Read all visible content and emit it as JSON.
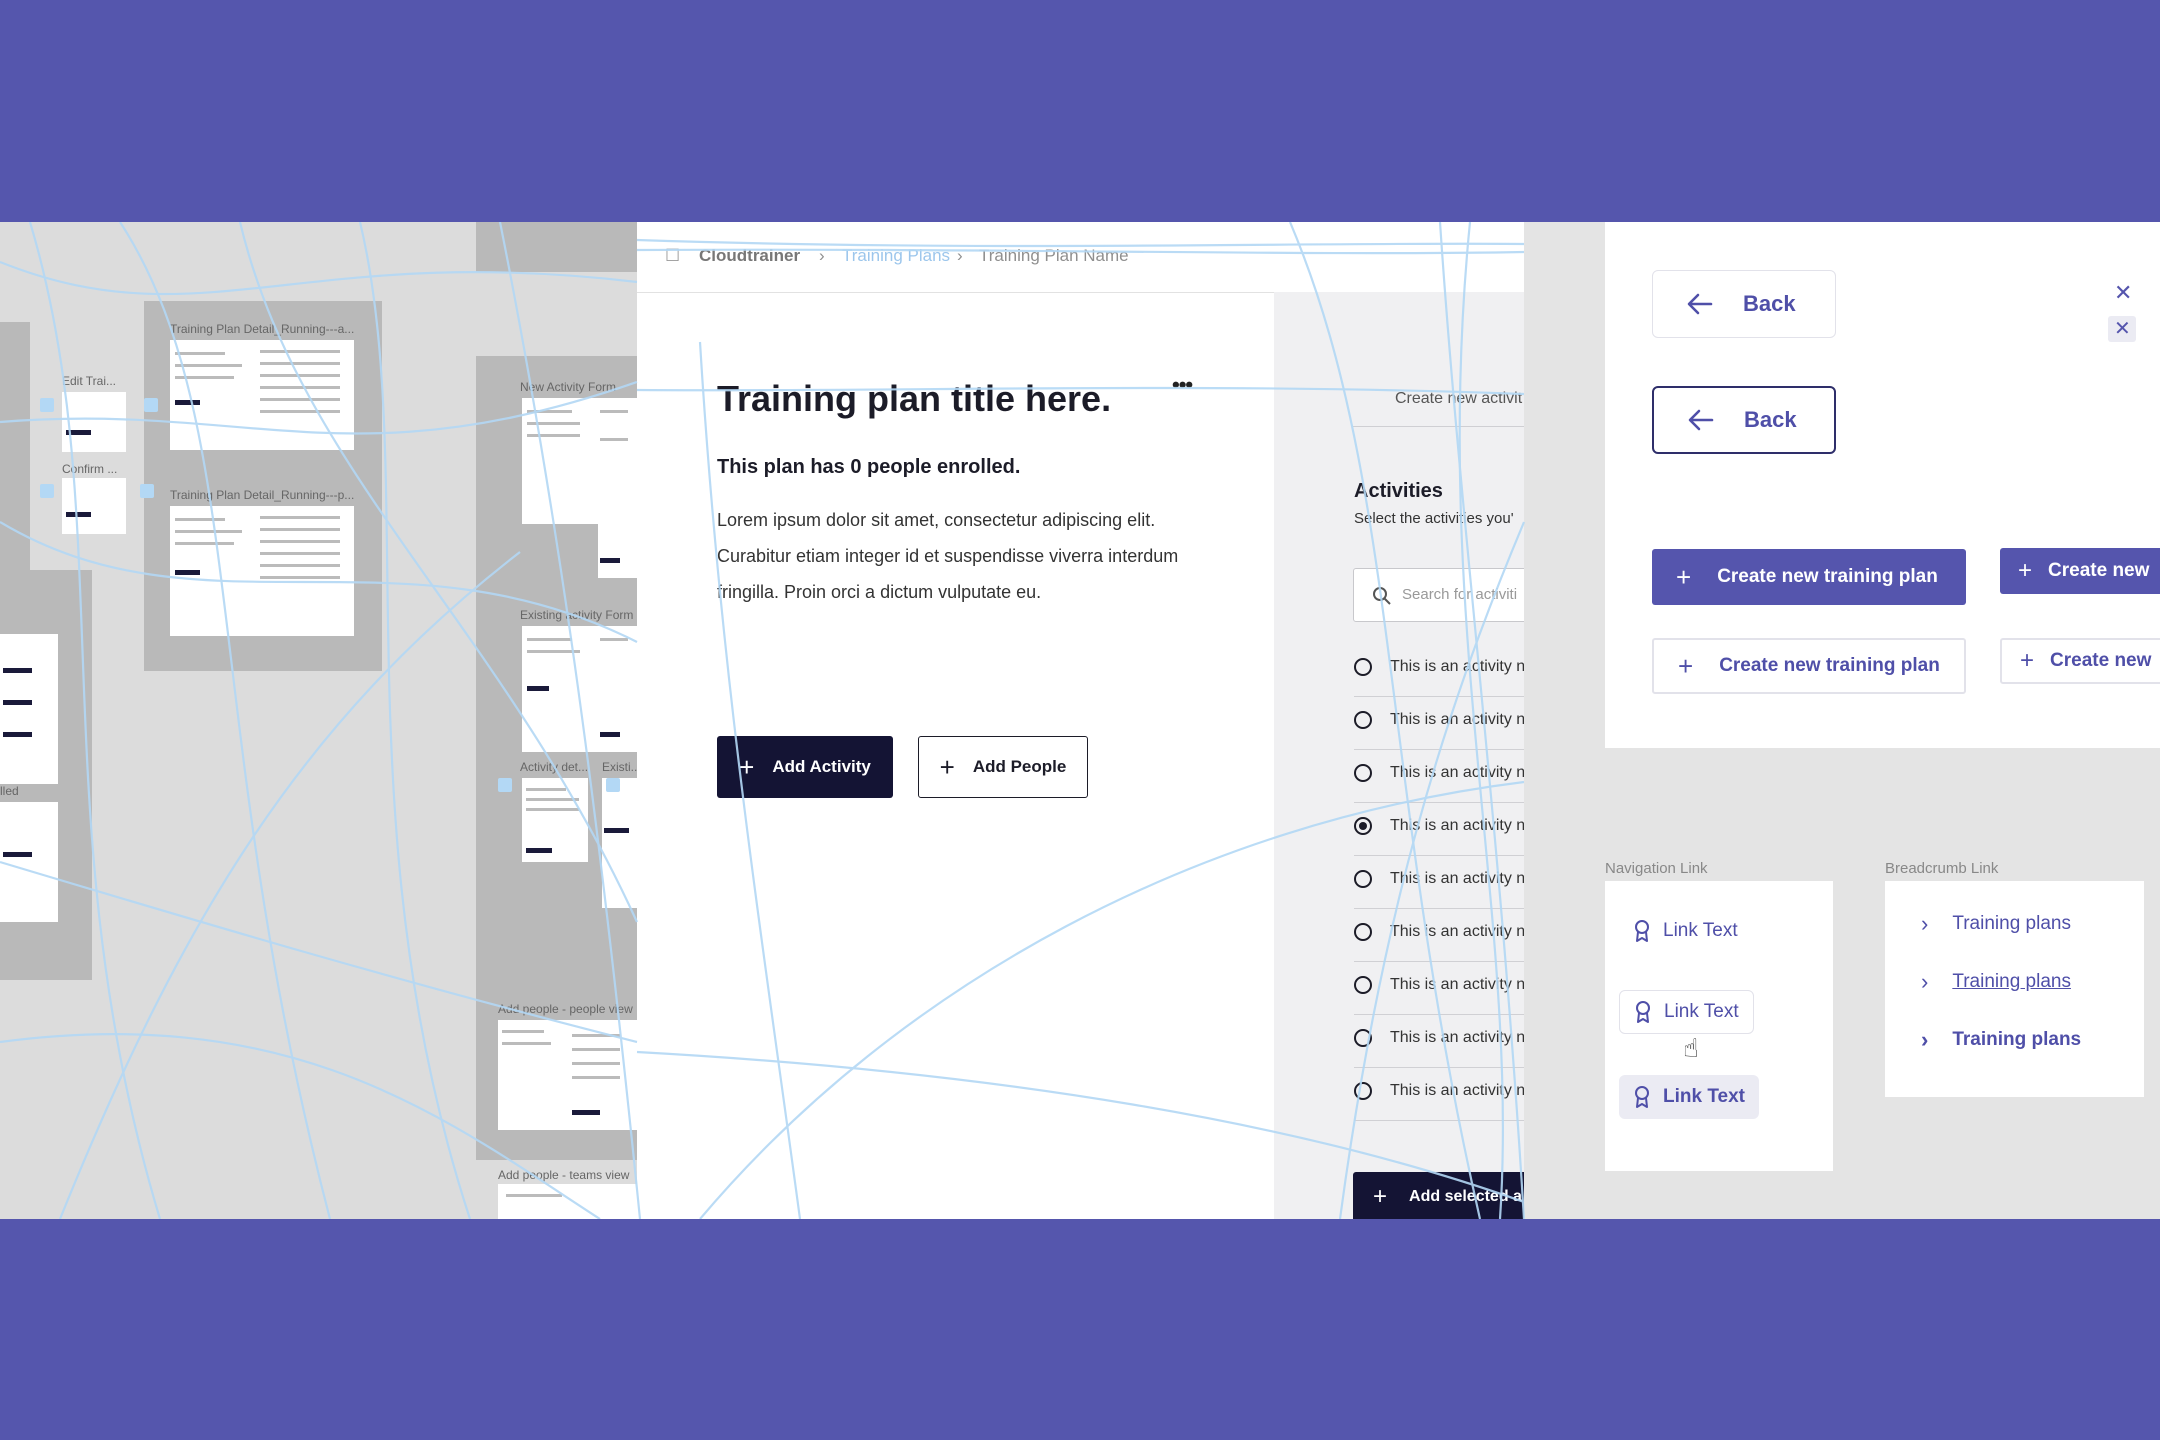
{
  "canvas": {
    "frame_labels": [
      "Training Plan Detail_Running---a...",
      "Training Plan Detail_Running---p...",
      "New Activity Form",
      "Existing activity Form",
      "Activity det...",
      "Existi...",
      "Add people - people view",
      "Add people - teams view",
      "Edit Trai...",
      "Confirm ...",
      "lled"
    ]
  },
  "app": {
    "breadcrumb": {
      "app_name": "Cloudtrainer",
      "section": "Training Plans",
      "current": "Training Plan Name"
    },
    "plan": {
      "title": "Training plan title here.",
      "enrolled_text": "This plan has 0 people enrolled.",
      "description": "Lorem ipsum dolor sit amet, consectetur adipiscing elit. Curabitur etiam integer id et suspendisse viverra interdum fringilla. Proin orci a dictum vulputate eu."
    },
    "actions": {
      "add_activity": "Add Activity",
      "add_people": "Add People"
    },
    "side_panel": {
      "create_link": "Create new activit",
      "heading": "Activities",
      "subheading": "Select the activities you'",
      "search_placeholder": "Search for activiti",
      "activities": [
        {
          "label": "This is an activity n",
          "selected": false
        },
        {
          "label": "This is an activity n",
          "selected": false
        },
        {
          "label": "This is an activity n",
          "selected": false
        },
        {
          "label": "This is an activity n",
          "selected": true
        },
        {
          "label": "This is an activity n",
          "selected": false
        },
        {
          "label": "This is an activity n",
          "selected": false
        },
        {
          "label": "This is an activity n",
          "selected": false
        },
        {
          "label": "This is an activity n",
          "selected": false
        },
        {
          "label": "This is an activity n",
          "selected": false
        }
      ],
      "add_selected": "Add selected a"
    }
  },
  "components": {
    "back_label": "Back",
    "create_plan_label": "Create new training plan",
    "create_plan_short": "Create new",
    "navigation_section_label": "Navigation Link",
    "breadcrumb_section_label": "Breadcrumb Link",
    "nav_link_text": "Link Text",
    "breadcrumb_link_text": "Training plans",
    "close_icon": "close-icon"
  },
  "colors": {
    "brand_purple": "#5555ad",
    "navy": "#141434",
    "link": "#4f4fa8"
  }
}
